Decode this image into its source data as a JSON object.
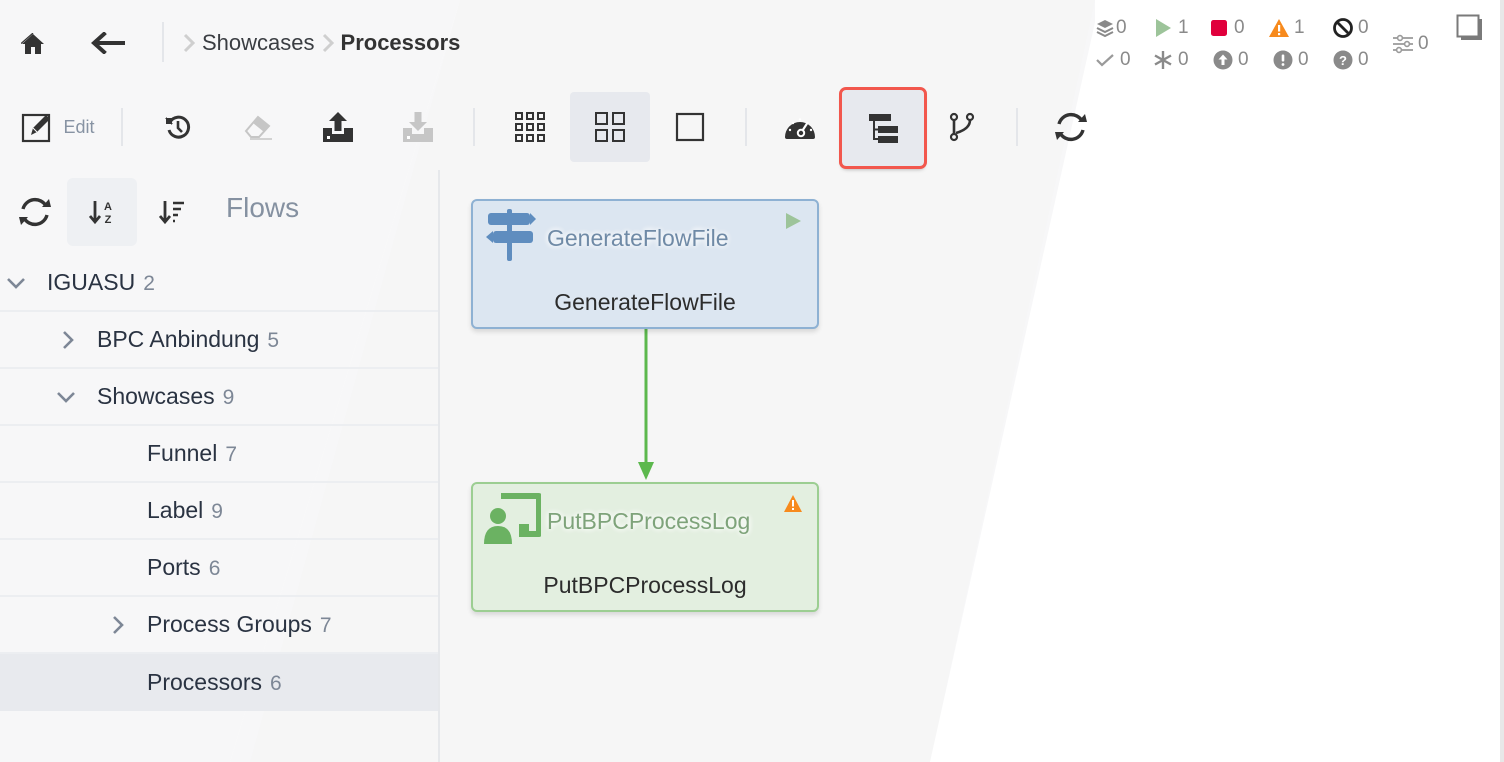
{
  "header": {
    "home_label": "Home",
    "back_label": "Back",
    "breadcrumb": [
      {
        "label": "Showcases",
        "current": false
      },
      {
        "label": "Processors",
        "current": true
      }
    ]
  },
  "status": {
    "row1": [
      {
        "icon": "layers-icon",
        "value": "0"
      },
      {
        "icon": "running-icon",
        "value": "1",
        "color": "#9dc49a"
      },
      {
        "icon": "stopped-icon",
        "value": "0",
        "color": "#e0003c"
      },
      {
        "icon": "invalid-warning-icon",
        "value": "1",
        "color": "#f78a1d"
      },
      {
        "icon": "disabled-icon",
        "value": "0"
      }
    ],
    "row2": [
      {
        "icon": "up-to-date-check-icon",
        "value": "0"
      },
      {
        "icon": "locally-modified-asterisk-icon",
        "value": "0"
      },
      {
        "icon": "stale-up-arrow-icon",
        "value": "0"
      },
      {
        "icon": "modified-stale-exclamation-icon",
        "value": "0"
      },
      {
        "icon": "sync-failure-question-icon",
        "value": "0"
      }
    ],
    "parameters": {
      "icon": "sliders-icon",
      "value": "0"
    }
  },
  "toolbar": {
    "edit_label": "Edit",
    "buttons": [
      {
        "name": "history-button",
        "icon": "history-icon",
        "enabled": true
      },
      {
        "name": "clear-button",
        "icon": "eraser-icon",
        "enabled": false
      },
      {
        "name": "upload-button",
        "icon": "upload-icon",
        "enabled": true
      },
      {
        "name": "download-button",
        "icon": "download-icon",
        "enabled": false
      },
      {
        "name": "grid-small-view-button",
        "icon": "grid-9-icon",
        "enabled": true
      },
      {
        "name": "grid-medium-view-button",
        "icon": "grid-4-icon",
        "enabled": true,
        "active": true
      },
      {
        "name": "single-view-button",
        "icon": "square-icon",
        "enabled": true
      },
      {
        "name": "dashboard-button",
        "icon": "speedometer-icon",
        "enabled": true
      },
      {
        "name": "tree-view-button",
        "icon": "tree-structure-icon",
        "enabled": true,
        "highlighted": true
      },
      {
        "name": "version-control-button",
        "icon": "branch-icon",
        "enabled": true
      },
      {
        "name": "refresh-button",
        "icon": "refresh-icon",
        "enabled": true
      }
    ]
  },
  "sidebar": {
    "title": "Flows",
    "tree": [
      {
        "label": "IGUASU",
        "count": "2",
        "level": 0,
        "expanded": true
      },
      {
        "label": "BPC Anbindung",
        "count": "5",
        "level": 1,
        "expanded": false
      },
      {
        "label": "Showcases",
        "count": "9",
        "level": 1,
        "expanded": true
      },
      {
        "label": "Funnel",
        "count": "7",
        "level": 2
      },
      {
        "label": "Label",
        "count": "9",
        "level": 2
      },
      {
        "label": "Ports",
        "count": "6",
        "level": 2
      },
      {
        "label": "Process Groups",
        "count": "7",
        "level": 2,
        "expanded": false
      },
      {
        "label": "Processors",
        "count": "6",
        "level": 2,
        "selected": true
      }
    ]
  },
  "canvas": {
    "processors": [
      {
        "type": "GenerateFlowFile",
        "name": "GenerateFlowFile",
        "state": "running",
        "icon": "signpost-icon",
        "color": "#5f8dbf"
      },
      {
        "type": "PutBPCProcessLog",
        "name": "PutBPCProcessLog",
        "state": "invalid",
        "icon": "presenter-board-icon",
        "color": "#6bb262"
      }
    ],
    "connection": {
      "from": "GenerateFlowFile",
      "to": "PutBPCProcessLog",
      "color": "#5cb84d"
    }
  }
}
